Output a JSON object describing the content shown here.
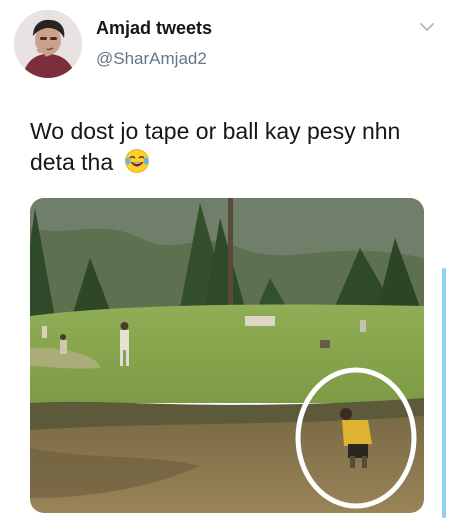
{
  "tweet": {
    "display_name": "Amjad tweets",
    "handle": "@SharAmjad2",
    "text": "Wo dost jo tape or ball kay pesy nhn deta tha",
    "emoji_icon": "face-with-tears-of-joy-icon",
    "menu_icon": "chevron-down-icon",
    "media_highlight_color": "#ffffff"
  }
}
